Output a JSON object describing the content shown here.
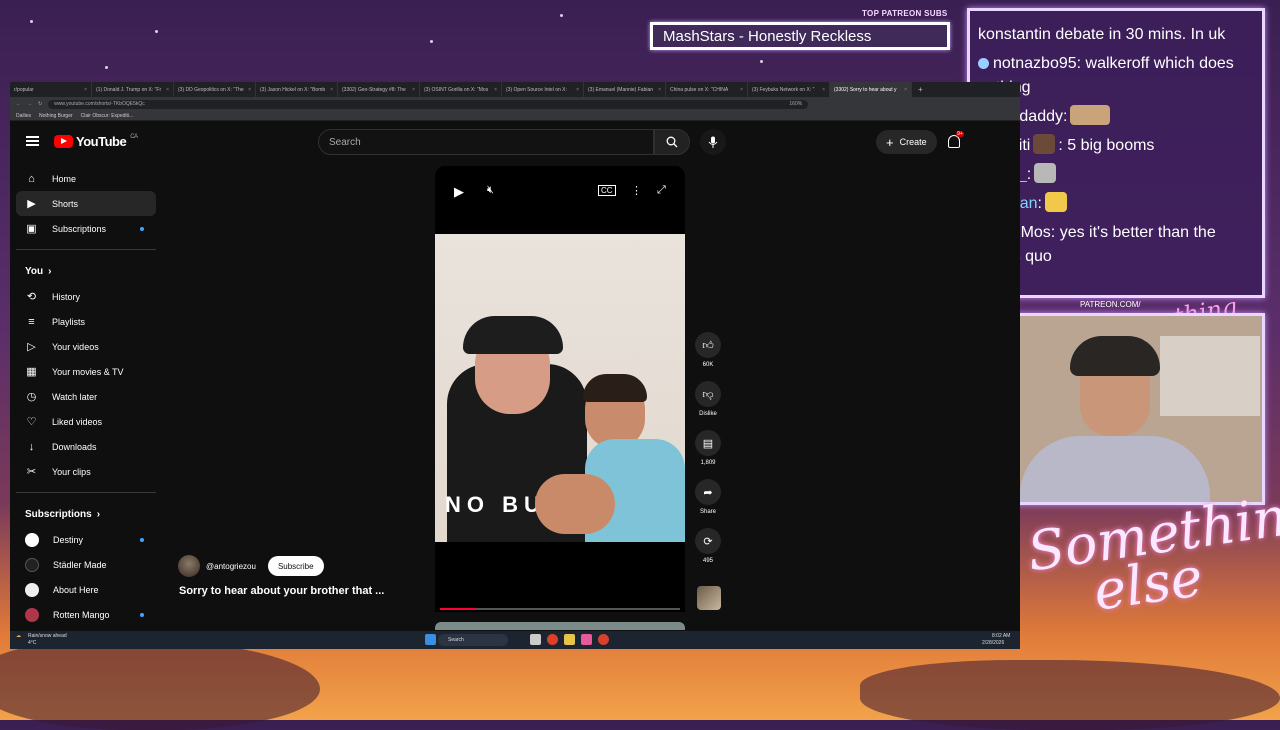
{
  "overlay": {
    "now_playing": "MashStars - Honestly Reckless",
    "patreon_subs_label": "TOP PATREON SUBS",
    "patreon_url": "PATREON.COM/",
    "signature": "Anything else?",
    "wordmark_line1": "Something",
    "wordmark_line2": "else"
  },
  "chat": {
    "messages": [
      {
        "user": "",
        "text": "konstantin debate in 30 mins. In uk"
      },
      {
        "user": "notnazbo95",
        "text": ": walkeroff which does nothing"
      },
      {
        "user": "huffdaddy",
        "text": ":"
      },
      {
        "user": "peciti",
        "text": ":  5 big booms"
      },
      {
        "user": "flac_",
        "text": ":"
      },
      {
        "user": "anpan",
        "text": ":"
      },
      {
        "user": "AntiMos",
        "text": ": yes it's better than the status quo"
      }
    ]
  },
  "browser": {
    "tabs": [
      "r/popular",
      "(1) Donald J. Trump on X: \"Fr",
      "(3) DD Geopolitics on X: \"The",
      "(3) Jason Hickel on X: \"Bomb",
      "(3302) Geo-Strategy #8: The",
      "(3) OSINT Gorilla on X: \"Mos",
      "(3) Open Source Intel on X:",
      "(3) Emanuel (Mannie) Fabian",
      "China pulse on X: \"CHINA",
      "(3) Feybuks Network on X: \"",
      "(3302) Sorry to hear about y"
    ],
    "url": "www.youtube.com/shorts/-TKbOQE5kQc",
    "zoom": "160%",
    "bookmarks": [
      "Dailies",
      "Nothing Burger",
      "Clair Obscur: Expediti..."
    ]
  },
  "youtube": {
    "logo_text": "YouTube",
    "region": "CA",
    "search_placeholder": "Search",
    "create_label": "Create",
    "notif_count": "9+",
    "sidebar": {
      "main": [
        {
          "label": "Home",
          "icon": "home-icon"
        },
        {
          "label": "Shorts",
          "icon": "shorts-icon"
        },
        {
          "label": "Subscriptions",
          "icon": "subscriptions-icon"
        }
      ],
      "you_heading": "You",
      "you_items": [
        {
          "label": "History",
          "icon": "history-icon"
        },
        {
          "label": "Playlists",
          "icon": "playlists-icon"
        },
        {
          "label": "Your videos",
          "icon": "your-videos-icon"
        },
        {
          "label": "Your movies & TV",
          "icon": "movies-icon"
        },
        {
          "label": "Watch later",
          "icon": "watch-later-icon"
        },
        {
          "label": "Liked videos",
          "icon": "liked-icon"
        },
        {
          "label": "Downloads",
          "icon": "download-icon"
        },
        {
          "label": "Your clips",
          "icon": "clips-icon"
        }
      ],
      "subs_heading": "Subscriptions",
      "subscriptions": [
        {
          "label": "Destiny"
        },
        {
          "label": "Städler Made"
        },
        {
          "label": "About Here"
        },
        {
          "label": "Rotten Mango"
        }
      ]
    },
    "short": {
      "channel": "@antogriezou",
      "subscribe_label": "Subscribe",
      "title": "Sorry to hear about your brother that ...",
      "shirt_text": "NO BUL",
      "likes": "60K",
      "dislike_label": "Dislike",
      "comments": "1,809",
      "share_label": "Share",
      "remix": "495",
      "progress": 0.15
    }
  },
  "taskbar": {
    "weather": "Rain/snow ahead",
    "temp": "4°C",
    "search_label": "Search",
    "time": "8:02 AM",
    "date": "2/28/2026"
  }
}
